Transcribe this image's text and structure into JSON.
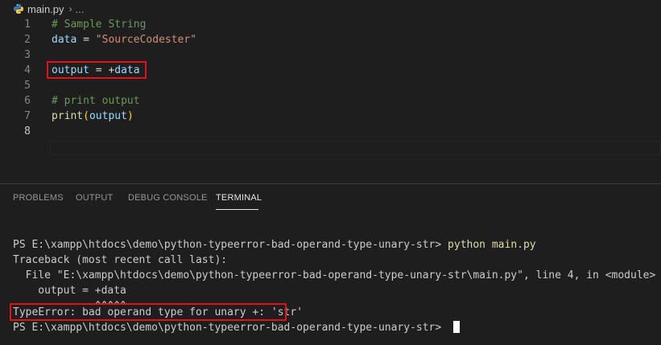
{
  "breadcrumb": {
    "file": "main.py",
    "separator": "›",
    "more": "..."
  },
  "editor": {
    "lines": [
      {
        "number": "1",
        "comment": "# Sample String"
      },
      {
        "number": "2",
        "var": "data",
        "op": " = ",
        "str": "\"SourceCodester\""
      },
      {
        "number": "3"
      },
      {
        "number": "4",
        "var": "output",
        "op": " = +",
        "var2": "data"
      },
      {
        "number": "5"
      },
      {
        "number": "6",
        "comment": "# print output"
      },
      {
        "number": "7",
        "fn": "print",
        "paren_open": "(",
        "var": "output",
        "paren_close": ")"
      },
      {
        "number": "8"
      }
    ]
  },
  "panel": {
    "tabs": [
      "PROBLEMS",
      "OUTPUT",
      "DEBUG CONSOLE",
      "TERMINAL"
    ],
    "active_tab": "TERMINAL"
  },
  "terminal": {
    "prompt1": "PS E:\\xampp\\htdocs\\demo\\python-typeerror-bad-operand-type-unary-str> ",
    "command": "python main.py",
    "traceback": "Traceback (most recent call last):",
    "file_line": "  File \"E:\\xampp\\htdocs\\demo\\python-typeerror-bad-operand-type-unary-str\\main.py\", line 4, in <module>",
    "code_line": "    output = +data",
    "caret_line": "             ^^^^^",
    "error": "TypeError: bad operand type for unary +: 'str'",
    "prompt2": "PS E:\\xampp\\htdocs\\demo\\python-typeerror-bad-operand-type-unary-str> "
  },
  "colors": {
    "background": "#1e1e1e",
    "highlight_box": "#e0121b",
    "comment": "#6a9955",
    "variable": "#9cdcfe",
    "string": "#ce9178",
    "function": "#dcdcaa"
  }
}
